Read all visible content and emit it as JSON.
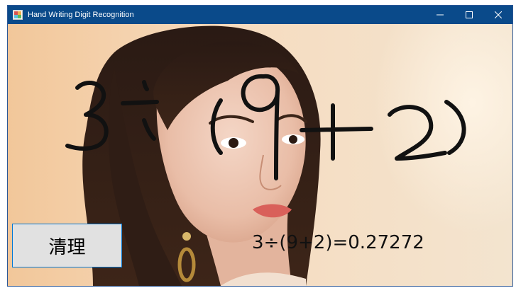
{
  "window": {
    "title": "Hand Writing Digit Recognition",
    "icon": "app-icon",
    "controls": {
      "minimize": "minimize-icon",
      "maximize": "maximize-icon",
      "close": "close-icon"
    }
  },
  "canvas": {
    "background": "portrait photo of a woman with long dark hair and an earring",
    "handwriting": "3÷(9+2)"
  },
  "buttons": {
    "clear_label": "清理"
  },
  "result": {
    "text": "3÷(9+2)=0.27272"
  },
  "colors": {
    "titlebar": "#0a4a8a",
    "button_border": "#0078d7",
    "ink": "#111111"
  }
}
